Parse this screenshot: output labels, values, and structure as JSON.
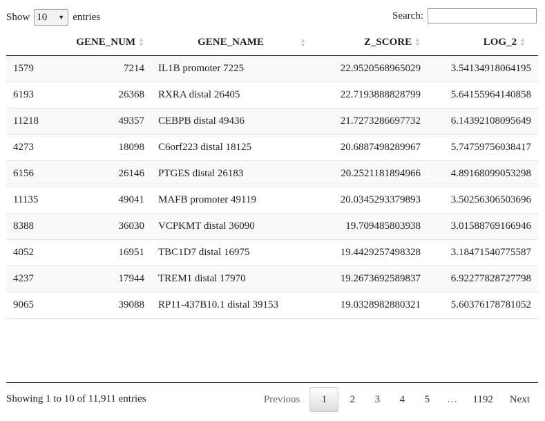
{
  "length_menu": {
    "prefix": "Show",
    "selected": "10",
    "suffix": "entries"
  },
  "search": {
    "label": "Search:",
    "value": ""
  },
  "columns": [
    {
      "key": "index",
      "label": ""
    },
    {
      "key": "gene_num",
      "label": "GENE_NUM"
    },
    {
      "key": "gene_name",
      "label": "GENE_NAME"
    },
    {
      "key": "z_score",
      "label": "Z_SCORE"
    },
    {
      "key": "log_2",
      "label": "LOG_2"
    }
  ],
  "rows": [
    [
      "1579",
      "7214",
      "IL1B promoter 7225",
      "22.9520568965029",
      "3.54134918064195"
    ],
    [
      "6193",
      "26368",
      "RXRA distal 26405",
      "22.7193888828799",
      "5.64155964140858"
    ],
    [
      "11218",
      "49357",
      "CEBPB distal 49436",
      "21.7273286697732",
      "6.14392108095649"
    ],
    [
      "4273",
      "18098",
      "C6orf223 distal 18125",
      "20.6887498289967",
      "5.74759756038417"
    ],
    [
      "6156",
      "26146",
      "PTGES distal 26183",
      "20.2521181894966",
      "4.89168099053298"
    ],
    [
      "11135",
      "49041",
      "MAFB promoter 49119",
      "20.0345293379893",
      "3.50256306503696"
    ],
    [
      "8388",
      "36030",
      "VCPKMT distal 36090",
      "19.709485803938",
      "3.01588769166946"
    ],
    [
      "4052",
      "16951",
      "TBC1D7 distal 16975",
      "19.4429257498328",
      "3.18471540775587"
    ],
    [
      "4237",
      "17944",
      "TREM1 distal 17970",
      "19.2673692589837",
      "6.92277828727798"
    ],
    [
      "9065",
      "39088",
      "RP11-437B10.1 distal 39153",
      "19.0328982880321",
      "5.60376178781052"
    ]
  ],
  "info": "Showing 1 to 10 of 11,911 entries",
  "pagination": {
    "previous": "Previous",
    "pages": [
      "1",
      "2",
      "3",
      "4",
      "5"
    ],
    "current": "1",
    "ellipsis": "…",
    "last": "1192",
    "next": "Next"
  }
}
